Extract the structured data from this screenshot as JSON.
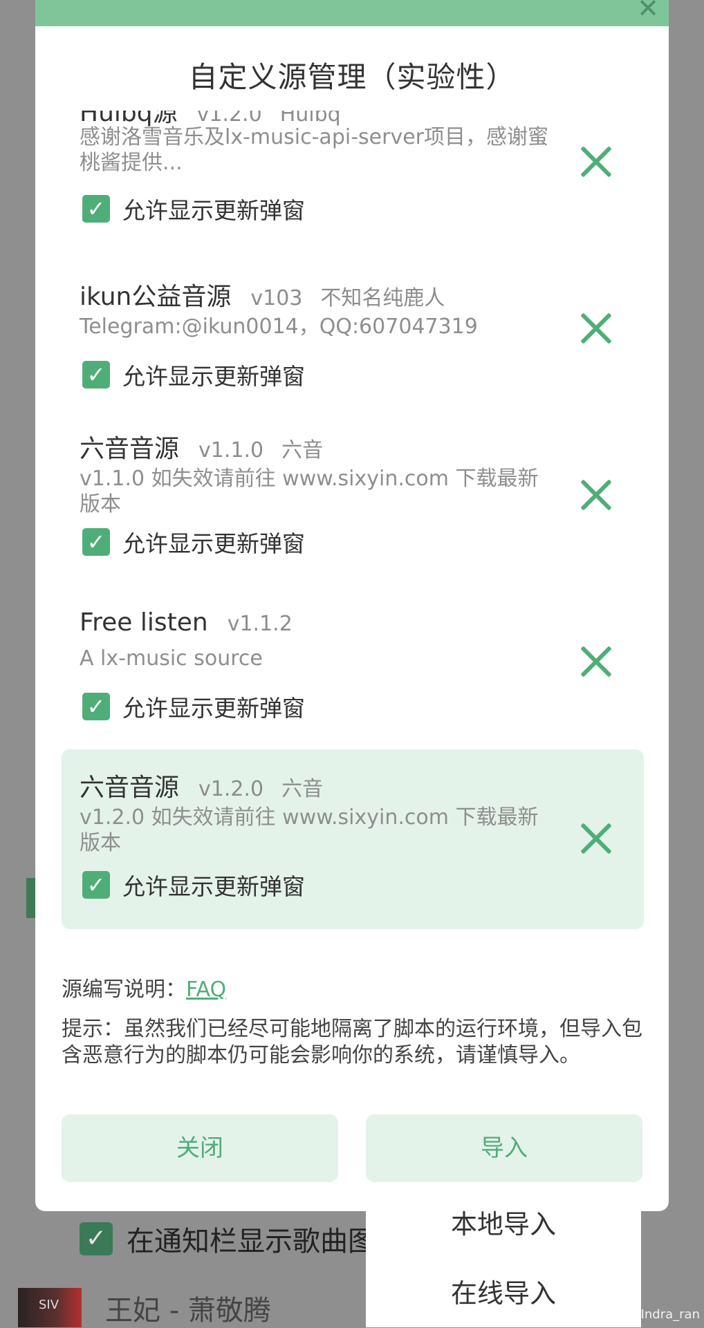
{
  "background": {
    "notify_label": "在通知栏显示歌曲图",
    "song": "王妃 - 萧敬腾",
    "cover_text": "SIV",
    "watermark": "CSDN @Indra_ran"
  },
  "dialog": {
    "close_glyph": "✕",
    "title": "自定义源管理（实验性）",
    "sources": [
      {
        "name": "Huibq源",
        "version": "v1.2.0",
        "author": "Huibq",
        "description": "感谢洛雪音乐及lx-music-api-server项目，感谢蜜桃酱提供...",
        "allow_update_label": "允许显示更新弹窗",
        "allow_update": true,
        "selected": false
      },
      {
        "name": "ikun公益音源",
        "version": "v103",
        "author": "不知名纯鹿人",
        "description": "Telegram:@ikun0014，QQ:607047319",
        "allow_update_label": "允许显示更新弹窗",
        "allow_update": true,
        "selected": false
      },
      {
        "name": "六音音源",
        "version": "v1.1.0",
        "author": "六音",
        "description": "v1.1.0 如失效请前往 www.sixyin.com 下载最新版本",
        "allow_update_label": "允许显示更新弹窗",
        "allow_update": true,
        "selected": false
      },
      {
        "name": "Free listen",
        "version": "v1.1.2",
        "author": "",
        "description": "A lx-music source",
        "allow_update_label": "允许显示更新弹窗",
        "allow_update": true,
        "selected": false
      },
      {
        "name": "六音音源",
        "version": "v1.2.0",
        "author": "六音",
        "description": "v1.2.0 如失效请前往 www.sixyin.com 下载最新版本",
        "allow_update_label": "允许显示更新弹窗",
        "allow_update": true,
        "selected": true
      }
    ],
    "faq_prefix": "源编写说明：",
    "faq_link": "FAQ",
    "tip": "提示：虽然我们已经尽可能地隔离了脚本的运行环境，但导入包含恶意行为的脚本仍可能会影响你的系统，请谨慎导入。",
    "close_button": "关闭",
    "import_button": "导入"
  },
  "import_menu": {
    "local": "本地导入",
    "online": "在线导入"
  },
  "colors": {
    "accent": "#4fae78",
    "selected_bg": "#e4f3ea",
    "topbar": "#7ec59a"
  }
}
